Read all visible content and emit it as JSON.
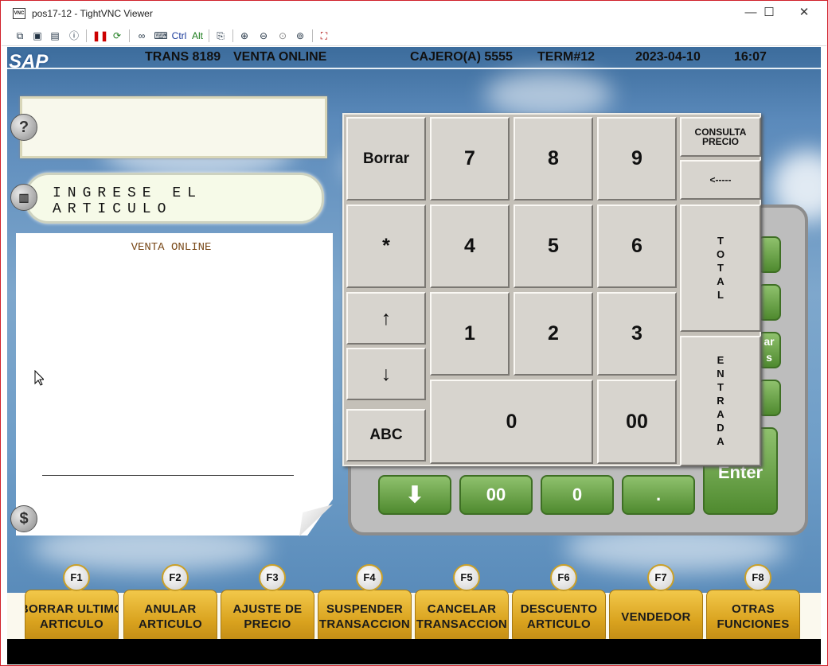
{
  "window": {
    "title": "pos17-12 - TightVNC Viewer",
    "minimize": "—",
    "maximize": "☐",
    "close": "✕"
  },
  "toolbar": {
    "ctrl": "Ctrl",
    "alt": "Alt"
  },
  "header": {
    "logo": "SAP",
    "trans": "TRANS 8189",
    "mode": "VENTA ONLINE",
    "cashier": "CAJERO(A) 5555",
    "term": "TERM#12",
    "date": "2023-04-10",
    "time": "16:07"
  },
  "help_icon": "?",
  "prompt": "INGRESE EL ARTICULO",
  "receipt": {
    "title": "VENTA ONLINE"
  },
  "money_icon": "$",
  "keypad": {
    "borrar": "Borrar",
    "k7": "7",
    "k8": "8",
    "k9": "9",
    "consulta": "CONSULTA\nPRECIO",
    "back": "<-----",
    "star": "*",
    "k4": "4",
    "k5": "5",
    "k6": "6",
    "total": "TOTAL",
    "up": "↑",
    "k1": "1",
    "k2": "2",
    "k3": "3",
    "entrada": "ENTRADA",
    "down": "↓",
    "abc": "ABC",
    "k0": "0",
    "k00": "00"
  },
  "bg_pad": {
    "enter": "Enter",
    "zz": "00",
    "z": "0",
    "dot": ".",
    "down": "⬇",
    "partial1": "ar",
    "partial2": "s"
  },
  "fkeys": [
    {
      "key": "F1",
      "label": "BORRAR ULTIMO\nARTICULO"
    },
    {
      "key": "F2",
      "label": "ANULAR\nARTICULO"
    },
    {
      "key": "F3",
      "label": "AJUSTE DE\nPRECIO"
    },
    {
      "key": "F4",
      "label": "SUSPENDER\nTRANSACCION"
    },
    {
      "key": "F5",
      "label": "CANCELAR\nTRANSACCION"
    },
    {
      "key": "F6",
      "label": "DESCUENTO\nARTICULO"
    },
    {
      "key": "F7",
      "label": "VENDEDOR"
    },
    {
      "key": "F8",
      "label": "OTRAS\nFUNCIONES"
    }
  ],
  "colors": {
    "accent_gold": "#d9a21e",
    "keypad_grey": "#d7d4ce",
    "pad_green": "#4f8a2f",
    "window_border": "#d0202a"
  }
}
